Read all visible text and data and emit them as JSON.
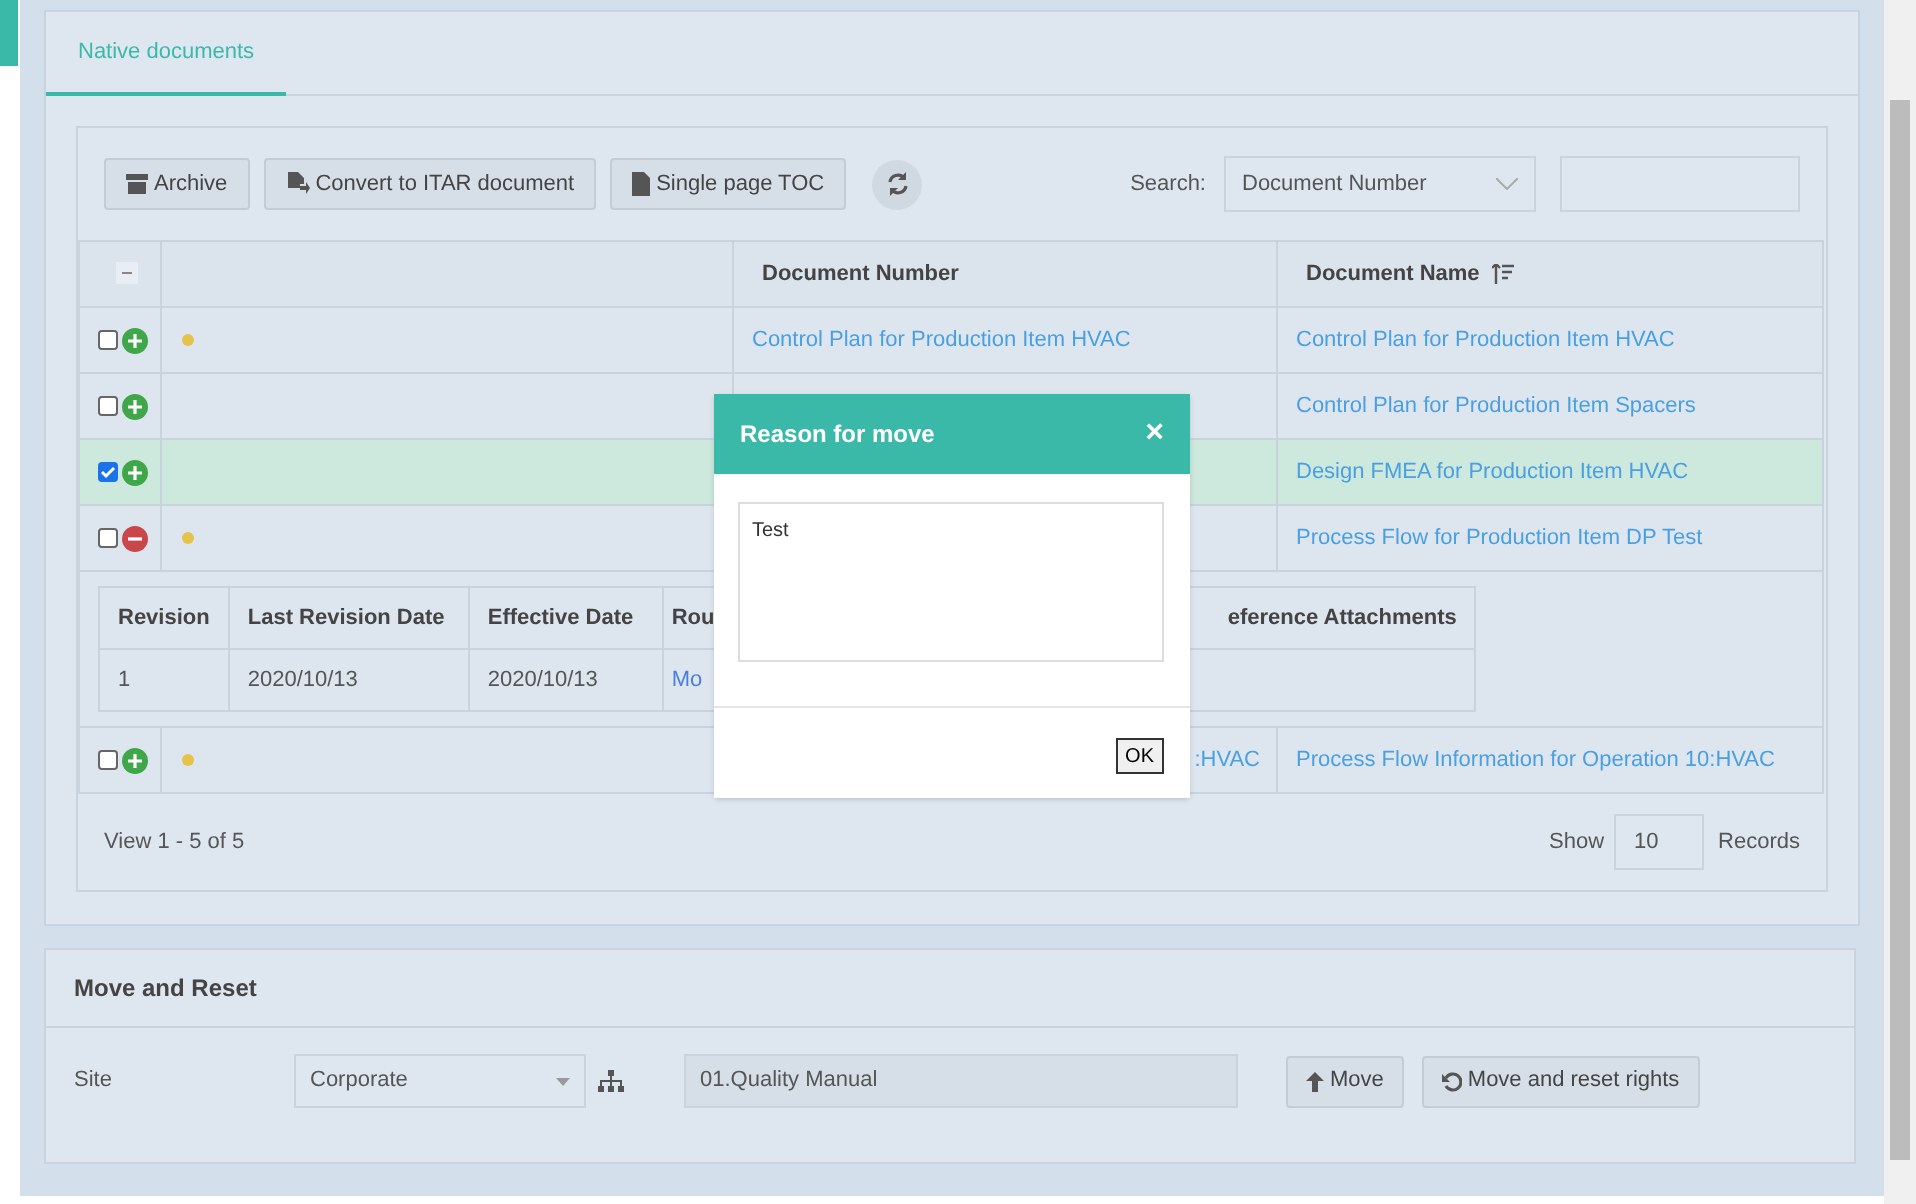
{
  "tabs": [
    {
      "label": "Native documents",
      "selected": true
    }
  ],
  "toolbar": {
    "buttons": [
      {
        "kind": "archive",
        "label": "Archive"
      },
      {
        "kind": "convert",
        "label": "Convert to ITAR document"
      },
      {
        "kind": "toc",
        "label": "Single page TOC"
      }
    ],
    "search_label": "Search:",
    "search_field": "Document Number"
  },
  "table": {
    "columns": [
      "Document Number",
      "Document Name"
    ],
    "rows": [
      {
        "checked": false,
        "expanded": false,
        "selected": false,
        "flagged": true,
        "document_number": "Control Plan for Production Item HVAC",
        "document_name": "Control Plan for Production Item HVAC"
      },
      {
        "checked": false,
        "expanded": false,
        "selected": false,
        "flagged": false,
        "document_name": "Control Plan for Production Item Spacers"
      },
      {
        "checked": true,
        "expanded": false,
        "selected": true,
        "flagged": false,
        "document_name": "Design FMEA for Production Item HVAC"
      },
      {
        "checked": false,
        "expanded": true,
        "selected": false,
        "flagged": true,
        "document_name": "Process Flow for Production Item DP Test",
        "details": {
          "columns": [
            "Revision",
            "Last Revision Date",
            "Effective Date",
            "Rou",
            "eference Attachments"
          ],
          "rows": [
            [
              "1",
              "2020/10/13",
              "2020/10/13",
              "Mo"
            ]
          ]
        }
      },
      {
        "checked": false,
        "expanded": false,
        "selected": false,
        "flagged": true,
        "document_number": ":HVAC",
        "document_name": "Process Flow Information for Operation 10:HVAC"
      }
    ]
  },
  "pager": {
    "view": "View 1 - 5 of 5",
    "show": "Show",
    "page_size": "10",
    "records": "Records"
  },
  "move_panel": {
    "title": "Move and Reset",
    "site_label": "Site",
    "site": "Corporate",
    "folder": "01.Quality Manual",
    "buttons": [
      {
        "kind": "move",
        "label": "Move"
      },
      {
        "kind": "reset",
        "label": "Move and reset rights"
      }
    ]
  },
  "dialog": {
    "title": "Reason for move",
    "close": "×",
    "value": "Test",
    "ok": "OK"
  }
}
